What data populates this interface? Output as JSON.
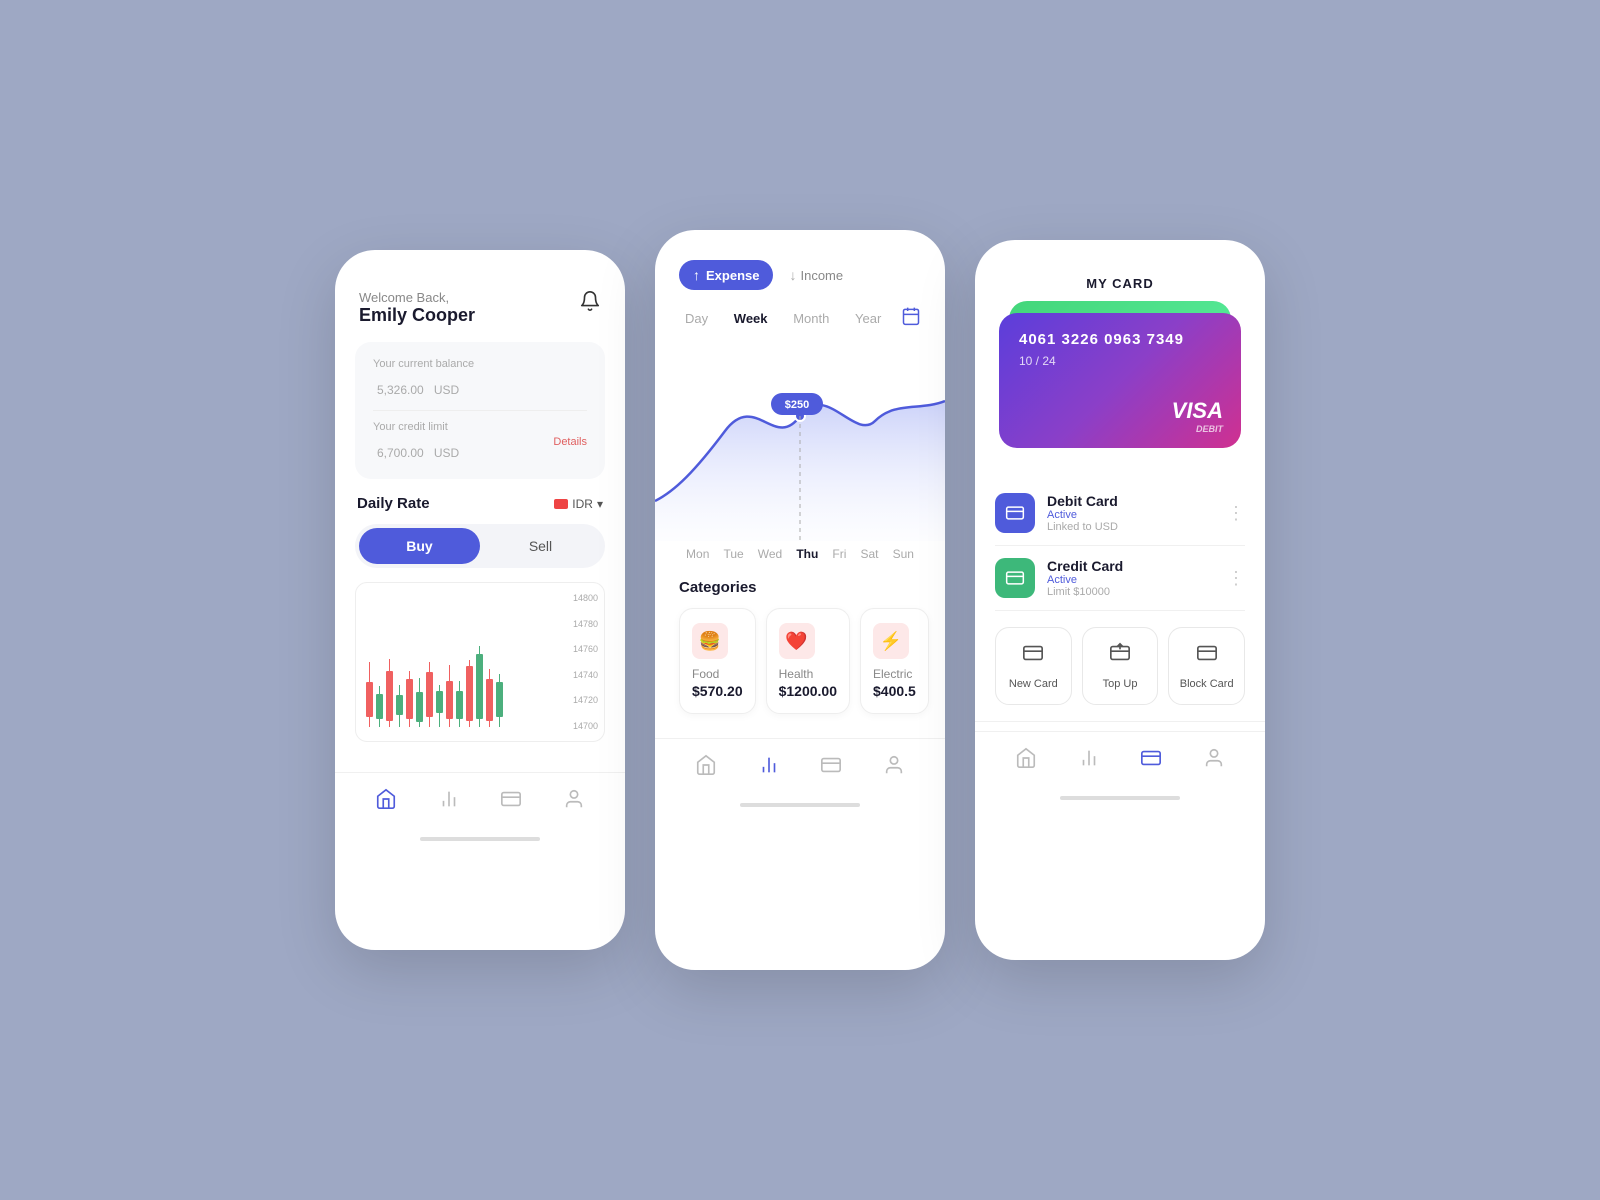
{
  "background": "#9ea8c4",
  "phone1": {
    "welcome": "Welcome Back,",
    "name": "Emily Cooper",
    "bell_icon": "🔔",
    "balance_label": "Your current balance",
    "balance_amount": "5,326.00",
    "balance_currency": "USD",
    "credit_label": "Your credit limit",
    "credit_amount": "6,700.00",
    "credit_currency": "USD",
    "details_link": "Details",
    "daily_rate_title": "Daily Rate",
    "idr_label": "IDR",
    "buy_label": "Buy",
    "sell_label": "Sell",
    "y_labels": [
      "14800",
      "14780",
      "14760",
      "14740",
      "14720",
      "14700"
    ]
  },
  "phone2": {
    "expense_label": "Expense",
    "income_label": "Income",
    "period_tabs": [
      "Day",
      "Week",
      "Month",
      "Year"
    ],
    "active_tab": "Week",
    "chart_point_label": "$250",
    "day_labels": [
      "Mon",
      "Tue",
      "Wed",
      "Thu",
      "Fri",
      "Sat",
      "Sun"
    ],
    "active_day": "Thu",
    "categories_title": "Categories",
    "categories": [
      {
        "name": "Food",
        "amount": "$570.20",
        "icon": "🍔"
      },
      {
        "name": "Health",
        "amount": "$1200.00",
        "icon": "❤️"
      },
      {
        "name": "Electric",
        "amount": "$400.5",
        "icon": "⚡"
      }
    ]
  },
  "phone3": {
    "title": "MY CARD",
    "card_number": "4061 3226 0963 7349",
    "card_expiry": "10 / 24",
    "visa_label": "VISA",
    "debit_label": "DEBIT",
    "cards": [
      {
        "name": "Debit Card",
        "status": "Active",
        "sub": "Linked to USD",
        "icon_color": "blue"
      },
      {
        "name": "Credit Card",
        "status": "Active",
        "sub": "Limit $10000",
        "icon_color": "green"
      }
    ],
    "actions": [
      {
        "label": "New Card",
        "icon": "🪪"
      },
      {
        "label": "Top Up",
        "icon": "💳"
      },
      {
        "label": "Block Card",
        "icon": "🚫"
      }
    ]
  },
  "nav": {
    "home_icon": "⌂",
    "chart_icon": "📊",
    "card_icon": "💳",
    "user_icon": "👤"
  }
}
